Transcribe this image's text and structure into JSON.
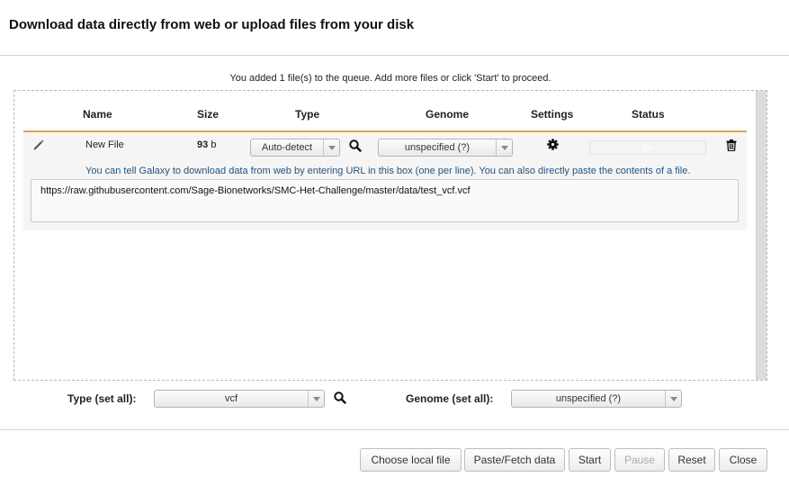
{
  "dialog": {
    "title": "Download data directly from web or upload files from your disk",
    "queue_message": "You added 1 file(s) to the queue. Add more files or click 'Start' to proceed."
  },
  "table": {
    "headers": {
      "name": "Name",
      "size": "Size",
      "type": "Type",
      "genome": "Genome",
      "settings": "Settings",
      "status": "Status"
    }
  },
  "file": {
    "name": "New File",
    "size_value": "93",
    "size_unit": "b",
    "type": "Auto-detect",
    "genome": "unspecified (?)",
    "progress_label": "0%",
    "progress": 0,
    "hint": "You can tell Galaxy to download data from web by entering URL in this box (one per line). You can also directly paste the contents of a file.",
    "url_content": "https://raw.githubusercontent.com/Sage-Bionetworks/SMC-Het-Challenge/master/data/test_vcf.vcf"
  },
  "set_all": {
    "type_label": "Type (set all):",
    "type_value": "vcf",
    "genome_label": "Genome (set all):",
    "genome_value": "unspecified (?)"
  },
  "buttons": {
    "choose_local": "Choose local file",
    "paste_fetch": "Paste/Fetch data",
    "start": "Start",
    "pause": "Pause",
    "reset": "Reset",
    "close": "Close"
  },
  "colors": {
    "header_underline": "#e8a33a",
    "hint_text": "#25537b"
  },
  "icons": [
    "pencil-icon",
    "search-icon",
    "gear-icon",
    "trash-icon",
    "chevron-down-icon"
  ]
}
